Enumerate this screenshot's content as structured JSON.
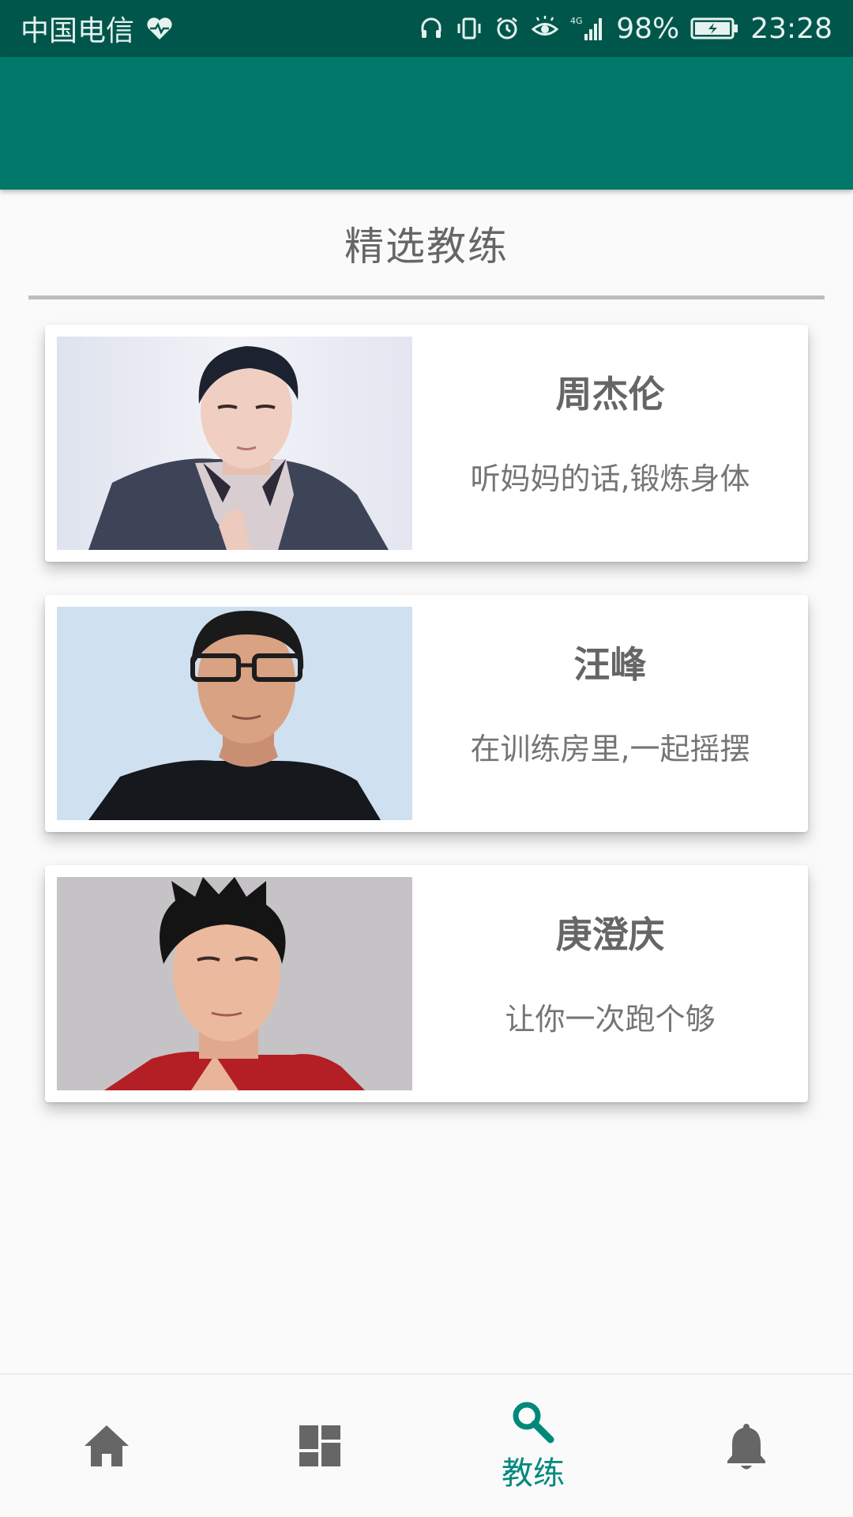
{
  "status_bar": {
    "carrier": "中国电信",
    "battery": "98%",
    "time": "23:28",
    "network": "4G"
  },
  "page": {
    "section_title": "精选教练"
  },
  "coaches": [
    {
      "name": "周杰伦",
      "motto": "听妈妈的话,锻炼身体"
    },
    {
      "name": "汪峰",
      "motto": "在训练房里,一起摇摆"
    },
    {
      "name": "庚澄庆",
      "motto": "让你一次跑个够"
    }
  ],
  "bottom_nav": {
    "items": [
      {
        "icon": "home-icon",
        "label": ""
      },
      {
        "icon": "dashboard-icon",
        "label": ""
      },
      {
        "icon": "search-icon",
        "label": "教练"
      },
      {
        "icon": "bell-icon",
        "label": ""
      }
    ],
    "active_index": 2
  },
  "colors": {
    "status_bar": "#00564b",
    "app_bar": "#00796b",
    "accent": "#00897b"
  }
}
